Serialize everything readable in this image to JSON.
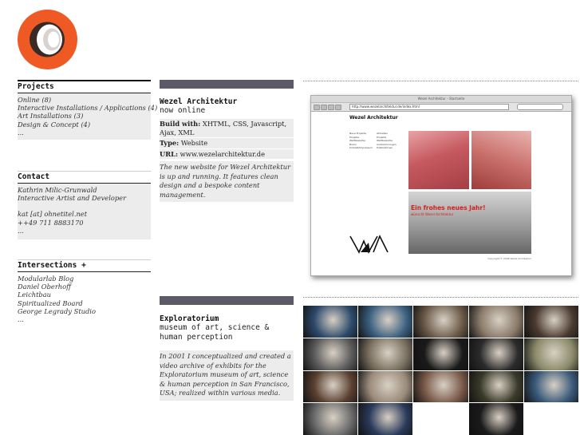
{
  "nav": {
    "projects": {
      "title": "Projects",
      "items": [
        "Online (8)",
        "Interactive Installations / Applications (4)",
        "Art Installations (3)",
        "Design & Concept (4)"
      ],
      "more": "..."
    },
    "contact": {
      "title": "Contact",
      "name": "Kathrin Milic-Grunwald",
      "role": "Interactive Artist and Developer",
      "email": "kat [at] ohnetitel.net",
      "phone": "++49 711 8883170",
      "more": "..."
    },
    "intersections": {
      "title": "Intersections +",
      "items": [
        "Modularlab Blog",
        "Daniel Oberhoff",
        "Leichtbau",
        "Spiritualized Board",
        "George Legrady Studio"
      ],
      "more": "..."
    }
  },
  "projects": [
    {
      "title": "Wezel Architektur",
      "subtitle": "now online",
      "build_label": "Build with:",
      "build_value": "XHTML, CSS, Javascript, Ajax, XML",
      "type_label": "Type:",
      "type_value": "Website",
      "url_label": "URL:",
      "url_value": "www.wezelarchitektur.de",
      "description": "The new website for Wezel Architektur is up and running. It features clean design and a bespoke content management."
    },
    {
      "title": "Exploratorium",
      "subtitle": "museum of art, science & human perception",
      "description": "In 2001 I conceptualized and created a video archive of exhibits for the Exploratorium museum of art, science & human perception in San Francisco, USA; realized within various media."
    }
  ],
  "screenshot": {
    "window_title": "Wezel Architektur - Startseite",
    "url": "http://www.wezelarchitektur.de/index.html",
    "site_title": "Wezel Architektur",
    "nav_left": [
      "Neue Projekte",
      "Projekte",
      "Wettbewerbe",
      "Buero",
      "Kontakt/Impressum"
    ],
    "nav_right": [
      "Aktuelles",
      "Projekte",
      "Wettbewerbe",
      "Auszeichnungen",
      "Publikationen"
    ],
    "greeting": "Ein frohes neues Jahr!",
    "greeting_sub": "wünscht Wezel Architektur",
    "copyright": "Copyright © 2008 Wezel Architektur"
  },
  "colors": {
    "logo_orange": "#ef5a24",
    "bar": "#5d5a68",
    "panel": "#ececec",
    "accent_red": "#d52020"
  },
  "thumbs": [
    "#2d4a6b",
    "#3a5f80",
    "#6b5a48",
    "#8a7a6a",
    "#4a3a30",
    "#5a5a5a",
    "#7a7060",
    "#1a1a1a",
    "#2b2b2b",
    "#8a8a6a",
    "#5a4030",
    "#9a8a7a",
    "#7a5a4a",
    "#3a3a2a",
    "#3a5a7a",
    "#6a6a6a",
    "#2a3a5a",
    "#ffffff",
    "#1a1a1a",
    "#ffffff"
  ]
}
